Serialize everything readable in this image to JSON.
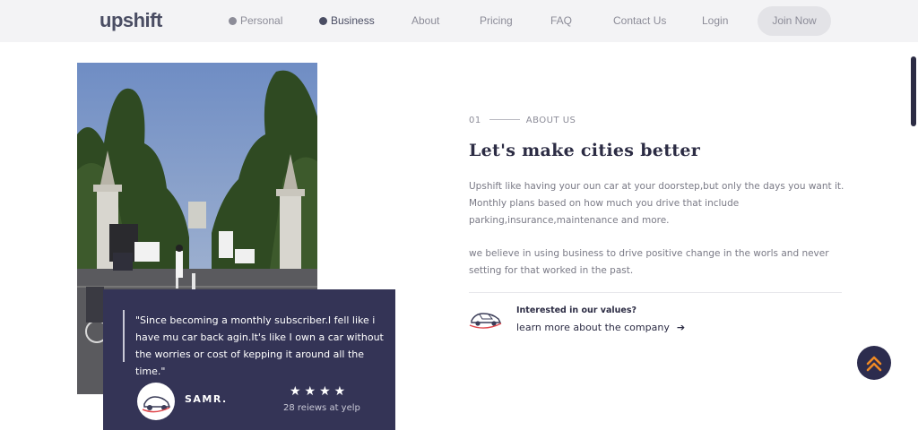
{
  "nav": {
    "logo": "upshift",
    "items": [
      {
        "label": "Personal"
      },
      {
        "label": "Business"
      },
      {
        "label": "About"
      },
      {
        "label": "Pricing"
      },
      {
        "label": "FAQ"
      },
      {
        "label": "Contact Us"
      },
      {
        "label": "Login"
      }
    ],
    "join_label": "Join Now"
  },
  "about": {
    "number": "01",
    "label": "ABOUT US",
    "heading": "Let's make cities better",
    "paragraph1": "Upshift like having your oun car at your doorstep,but only the days you want it. Monthly plans based on how much you drive that include parking,insurance,maintenance and more.",
    "paragraph2": "we believe in using business to drive positive change in the worls and never setting for that worked in the past.",
    "cta_question": "Interested in our values?",
    "cta_link": "learn more about the company"
  },
  "testimonial": {
    "quote": "\"Since becoming a monthly subscriber.I fell like i have mu car back agin.It's like I own a car without the worries or cost of kepping it around all the time.\"",
    "author": "SAMR.",
    "stars": "★★★★",
    "rating": 4,
    "reviews": "28 reiews at yelp"
  },
  "icons": {
    "cta": "car-icon",
    "cta_arrow": "arrow-right-icon",
    "scroll_top": "chevron-double-up-icon"
  },
  "colors": {
    "brand_dark": "#343456",
    "accent_orange": "#f08a24",
    "nav_bg": "#f3f3f5"
  }
}
